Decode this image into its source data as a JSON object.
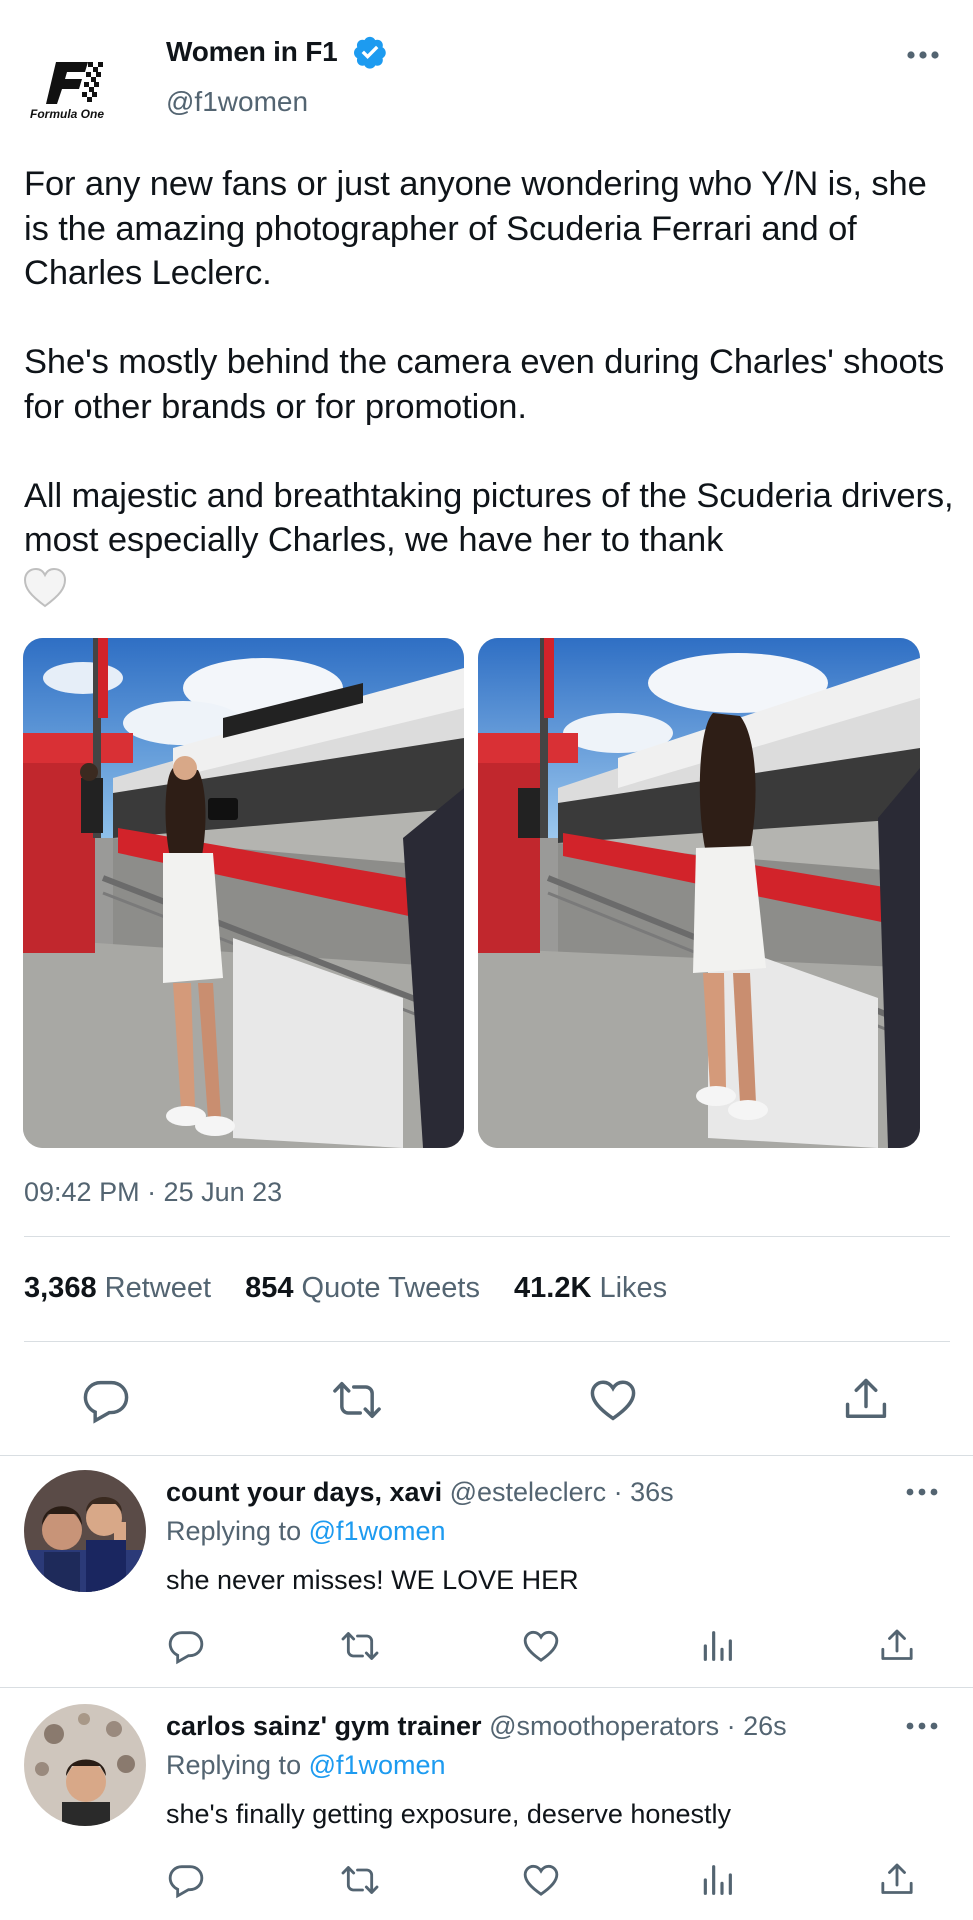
{
  "tweet": {
    "author_name": "Women in F1",
    "handle": "@f1women",
    "logo_text": "Formula One",
    "text": "For any new fans or just anyone wondering who Y/N is, she is the amazing photographer of Scuderia Ferrari and of Charles Leclerc.\n\nShe's mostly behind the camera even during Charles' shoots for other brands or for promotion.\n\nAll majestic and breathtaking pictures of the Scuderia drivers, most especially Charles, we have her to thank",
    "timestamp": "09:42 PM · 25 Jun 23",
    "stats": {
      "retweets_count": "3,368",
      "retweets_label": "Retweet",
      "quotes_count": "854",
      "quotes_label": "Quote Tweets",
      "likes_count": "41.2K",
      "likes_label": "Likes"
    }
  },
  "replies": [
    {
      "name": "count your days, xavi",
      "handle": "@esteleclerc",
      "time": "· 36s",
      "replying_prefix": "Replying to",
      "replying_to": "@f1women",
      "text": "she never misses! WE LOVE HER"
    },
    {
      "name": "carlos sainz' gym trainer",
      "handle": "@smoothoperators",
      "time": "· 26s",
      "replying_prefix": "Replying to",
      "replying_to": "@f1women",
      "text": "she's finally getting exposure, deserve honestly"
    }
  ],
  "colors": {
    "verified": "#1d9bf0",
    "link": "#1d9bf0",
    "muted": "#536471",
    "pit_lane_red": "#d2232a",
    "sky": "#3a7fd0"
  }
}
